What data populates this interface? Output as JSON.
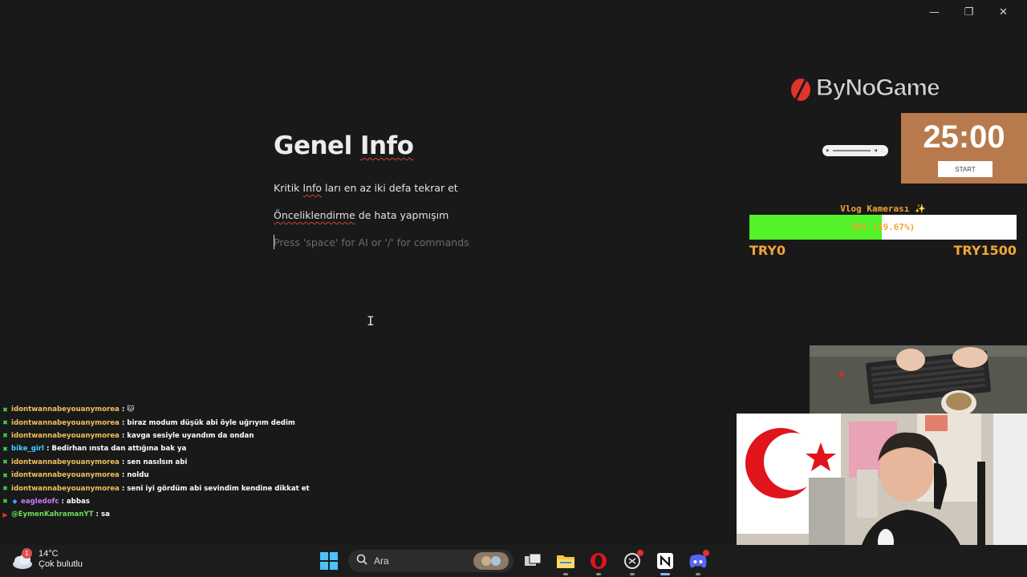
{
  "window": {
    "minimize_glyph": "—",
    "maximize_glyph": "❐",
    "close_glyph": "✕"
  },
  "document": {
    "title_word1": "Genel",
    "title_word2": "Info",
    "line1_a": "Kritik ",
    "line1_err": "Info",
    "line1_b": " ları en az iki defa tekrar et",
    "line2_err": "Önceliklendirme",
    "line2_b": " de hata yapmışım",
    "placeholder": "Press 'space' for AI or '/' for commands"
  },
  "overlay": {
    "brand": "ByNoGame",
    "timer": {
      "value": "25:00",
      "button": "START"
    },
    "goal": {
      "title": "Vlog Kamerası ✨",
      "percent_label": "TRY (49.67%)",
      "progress": 0.4967,
      "min_label": "TRY0",
      "max_label": "TRY1500",
      "fill_color": "#53f22a",
      "text_color": "#f2a531"
    },
    "audio_player": {
      "icon": "play-icon"
    }
  },
  "chat": [
    {
      "icon": "✖",
      "icon_color": "#44e04a",
      "user": "idontwannabeyouanymorea",
      "user_color": "#f0c05a",
      "text": ": 🐱"
    },
    {
      "icon": "✖",
      "icon_color": "#44e04a",
      "user": "idontwannabeyouanymorea",
      "user_color": "#f0c05a",
      "text": ": biraz modum düşük abi öyle uğrıyım dedim"
    },
    {
      "icon": "✖",
      "icon_color": "#44e04a",
      "user": "idontwannabeyouanymorea",
      "user_color": "#f0c05a",
      "text": ": kavga sesiyle uyandım da ondan"
    },
    {
      "icon": "✖",
      "icon_color": "#44e04a",
      "user": "bike_girl",
      "user_color": "#3fd0ff",
      "text": ": Bedirhan ınsta dan attığına bak ya"
    },
    {
      "icon": "✖",
      "icon_color": "#44e04a",
      "user": "idontwannabeyouanymorea",
      "user_color": "#f0c05a",
      "text": ": sen nasılsın abi"
    },
    {
      "icon": "✖",
      "icon_color": "#44e04a",
      "user": "idontwannabeyouanymorea",
      "user_color": "#f0c05a",
      "text": ": noldu"
    },
    {
      "icon": "✖",
      "icon_color": "#44e04a",
      "user": "idontwannabeyouanymorea",
      "user_color": "#f0c05a",
      "text": ": seni iyi gördüm abi sevindim kendine dikkat et"
    },
    {
      "icon": "✖",
      "icon_color": "#44e04a",
      "icon2": "◆",
      "user": "eagledofc",
      "user_color": "#c97bff",
      "text": ": abbas"
    },
    {
      "icon": "▶",
      "icon_color": "#ff3030",
      "user": "@EymenKahramanYT",
      "user_color": "#6fdc5a",
      "text": ": sa"
    }
  ],
  "taskbar": {
    "weather": {
      "temp": "14°C",
      "desc": "Çok bulutlu",
      "badge": "1"
    },
    "search_label": "Ara",
    "apps": [
      "windows-start-icon",
      "search-icon",
      "task-view-icon",
      "file-explorer-icon",
      "opera-icon",
      "chatgpt-icon",
      "notion-icon",
      "discord-icon"
    ]
  }
}
